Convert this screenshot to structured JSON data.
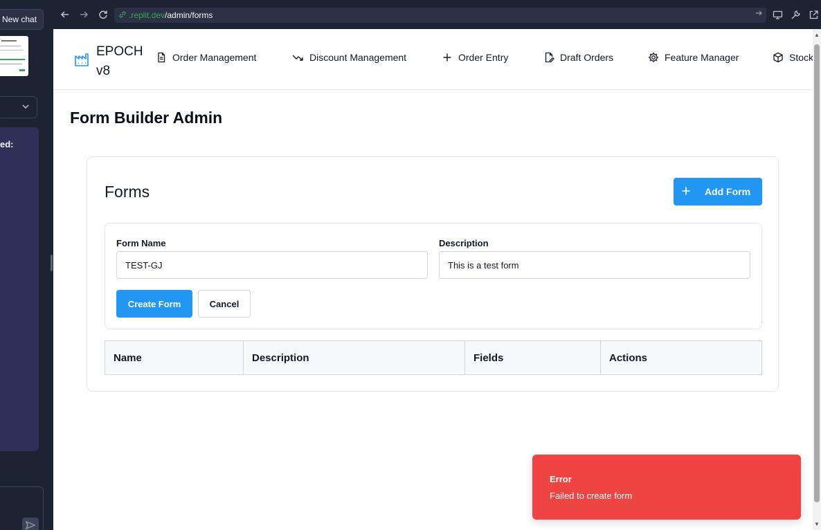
{
  "replit": {
    "new_chat_label": "New chat",
    "message_snippet": "ed:",
    "send_icon": "paper-plane-icon"
  },
  "browser": {
    "url_host": ".replit.dev",
    "url_path": "/admin/forms"
  },
  "app": {
    "brand": "EPOCH v8",
    "nav": [
      {
        "label": "Order Management",
        "icon": "document-icon"
      },
      {
        "label": "Discount Management",
        "icon": "trend-down-icon"
      },
      {
        "label": "Order Entry",
        "icon": "plus-icon"
      },
      {
        "label": "Draft Orders",
        "icon": "edit-document-icon"
      },
      {
        "label": "Feature Manager",
        "icon": "gear-icon"
      },
      {
        "label": "Stock",
        "icon": "box-icon"
      }
    ],
    "accent_color": "#2196f3"
  },
  "page": {
    "title": "Form Builder Admin"
  },
  "forms_card": {
    "title": "Forms",
    "add_button": "Add Form",
    "form": {
      "name_label": "Form Name",
      "name_value": "TEST-GJ",
      "description_label": "Description",
      "description_value": "This is a test form",
      "create_button": "Create Form",
      "cancel_button": "Cancel"
    },
    "table": {
      "headers": [
        "Name",
        "Description",
        "Fields",
        "Actions"
      ]
    }
  },
  "toast": {
    "title": "Error",
    "message": "Failed to create form",
    "color": "#ef4444"
  }
}
